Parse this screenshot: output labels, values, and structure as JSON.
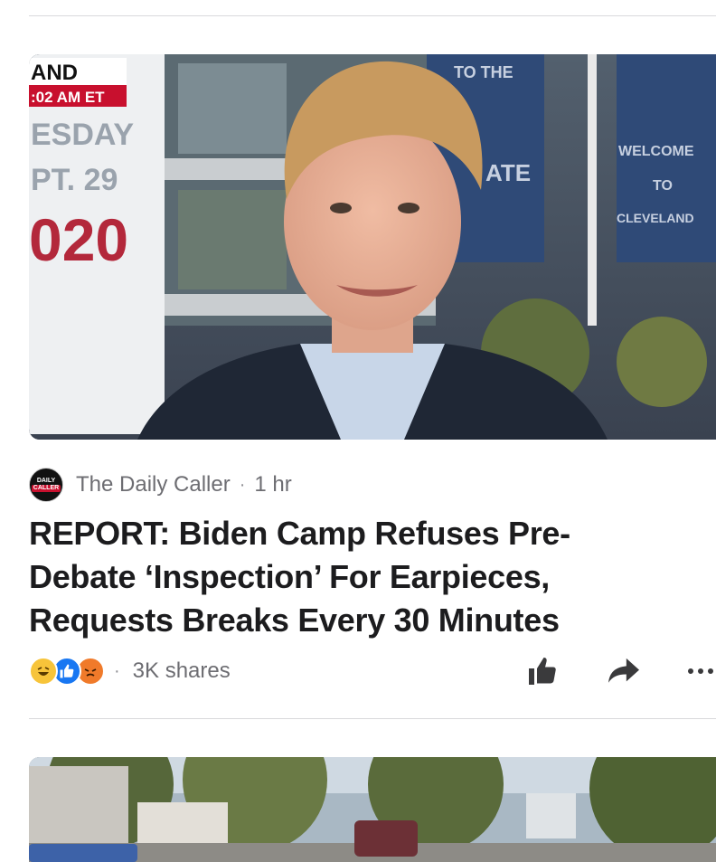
{
  "article": {
    "source": "The Daily Caller",
    "source_logo": {
      "line1": "DAILY",
      "line2": "CALLER"
    },
    "time": "1 hr",
    "headline": "REPORT: Biden Camp Refuses Pre-Debate ‘Inspection’ For Earpieces, Requests Breaks Every 30 Minutes",
    "shares": "3K shares",
    "reactions": [
      "haha-icon",
      "like-icon",
      "angry-icon"
    ],
    "image_overlay": {
      "band_line1": "AND",
      "band_time": ":02 AM ET",
      "banner_day": "ESDAY",
      "banner_date": "PT. 29",
      "banner_year": "020",
      "sign_top": "TO THE",
      "sign_mid": "ATE",
      "sign_welcome": "WELCOME",
      "sign_to": "TO",
      "sign_city": "CLEVELAND"
    }
  },
  "actions": {
    "like": "thumbs-up-icon",
    "share": "share-arrow-icon",
    "more": "more-icon"
  },
  "colors": {
    "text_primary": "#1c1c1e",
    "text_secondary": "#6d6d72",
    "divider": "#d9d9dc",
    "like_blue": "#1877f2",
    "fox_red": "#c8102e"
  }
}
